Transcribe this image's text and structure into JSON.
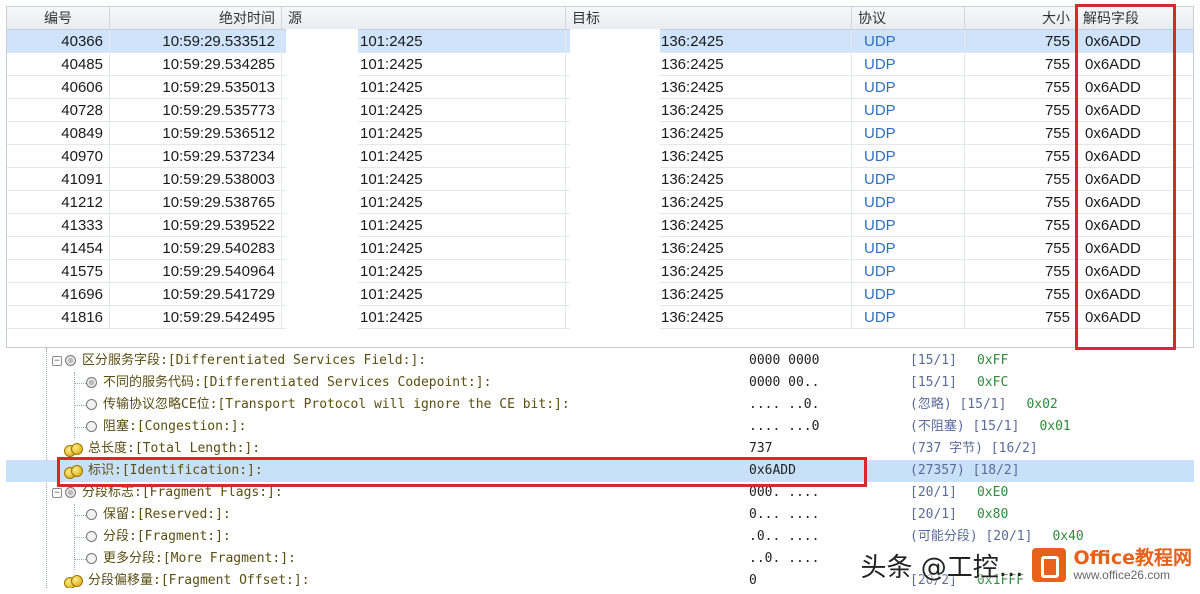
{
  "table": {
    "headers": {
      "id": "编号",
      "time": "绝对时间",
      "src": "源",
      "dst": "目标",
      "proto": "协议",
      "size": "大小",
      "decode": "解码字段"
    },
    "rows": [
      {
        "id": "40366",
        "time": "10:59:29.533512",
        "src": "101:2425",
        "dst": "136:2425",
        "proto": "UDP",
        "size": "755",
        "decode": "0x6ADD"
      },
      {
        "id": "40485",
        "time": "10:59:29.534285",
        "src": "101:2425",
        "dst": "136:2425",
        "proto": "UDP",
        "size": "755",
        "decode": "0x6ADD"
      },
      {
        "id": "40606",
        "time": "10:59:29.535013",
        "src": "101:2425",
        "dst": "136:2425",
        "proto": "UDP",
        "size": "755",
        "decode": "0x6ADD"
      },
      {
        "id": "40728",
        "time": "10:59:29.535773",
        "src": "101:2425",
        "dst": "136:2425",
        "proto": "UDP",
        "size": "755",
        "decode": "0x6ADD"
      },
      {
        "id": "40849",
        "time": "10:59:29.536512",
        "src": "101:2425",
        "dst": "136:2425",
        "proto": "UDP",
        "size": "755",
        "decode": "0x6ADD"
      },
      {
        "id": "40970",
        "time": "10:59:29.537234",
        "src": "101:2425",
        "dst": "136:2425",
        "proto": "UDP",
        "size": "755",
        "decode": "0x6ADD"
      },
      {
        "id": "41091",
        "time": "10:59:29.538003",
        "src": "101:2425",
        "dst": "136:2425",
        "proto": "UDP",
        "size": "755",
        "decode": "0x6ADD"
      },
      {
        "id": "41212",
        "time": "10:59:29.538765",
        "src": "101:2425",
        "dst": "136:2425",
        "proto": "UDP",
        "size": "755",
        "decode": "0x6ADD"
      },
      {
        "id": "41333",
        "time": "10:59:29.539522",
        "src": "101:2425",
        "dst": "136:2425",
        "proto": "UDP",
        "size": "755",
        "decode": "0x6ADD"
      },
      {
        "id": "41454",
        "time": "10:59:29.540283",
        "src": "101:2425",
        "dst": "136:2425",
        "proto": "UDP",
        "size": "755",
        "decode": "0x6ADD"
      },
      {
        "id": "41575",
        "time": "10:59:29.540964",
        "src": "101:2425",
        "dst": "136:2425",
        "proto": "UDP",
        "size": "755",
        "decode": "0x6ADD"
      },
      {
        "id": "41696",
        "time": "10:59:29.541729",
        "src": "101:2425",
        "dst": "136:2425",
        "proto": "UDP",
        "size": "755",
        "decode": "0x6ADD"
      },
      {
        "id": "41816",
        "time": "10:59:29.542495",
        "src": "101:2425",
        "dst": "136:2425",
        "proto": "UDP",
        "size": "755",
        "decode": "0x6ADD"
      }
    ]
  },
  "tree": [
    {
      "label": "区分服务字段:[Differentiated Services Field:]:",
      "value": "0000 0000",
      "info": "[15/1]",
      "hex": "0xFF"
    },
    {
      "label": "不同的服务代码:[Differentiated Services Codepoint:]:",
      "value": "0000 00..",
      "info": "[15/1]",
      "hex": "0xFC"
    },
    {
      "label": "传输协议忽略CE位:[Transport Protocol will ignore the CE bit:]:",
      "value": ".... ..0.",
      "info": "(忽略)   [15/1]",
      "hex": "0x02"
    },
    {
      "label": "阻塞:[Congestion:]:",
      "value": ".... ...0",
      "info": "(不阻塞)   [15/1]",
      "hex": "0x01"
    },
    {
      "label": "总长度:[Total Length:]:",
      "value": "737",
      "info": "(737 字节)   [16/2]",
      "hex": ""
    },
    {
      "label": "标识:[Identification:]:",
      "value": "0x6ADD",
      "info": "(27357)   [18/2]",
      "hex": ""
    },
    {
      "label": "分段标志:[Fragment Flags:]:",
      "value": "000. ....",
      "info": "[20/1]",
      "hex": "0xE0"
    },
    {
      "label": "保留:[Reserved:]:",
      "value": "0... ....",
      "info": "[20/1]",
      "hex": "0x80"
    },
    {
      "label": "分段:[Fragment:]:",
      "value": ".0.. ....",
      "info": "(可能分段)   [20/1]",
      "hex": "0x40"
    },
    {
      "label": "更多分段:[More Fragment:]:",
      "value": "..0. ....",
      "info": "",
      "hex": ""
    },
    {
      "label": "分段偏移量:[Fragment Offset:]:",
      "value": "0",
      "info": "[20/2]",
      "hex": "0x1FFF"
    }
  ],
  "watermark": {
    "text": "头条 @工控...",
    "site": "Office教程网",
    "url": "www.office26.com"
  }
}
